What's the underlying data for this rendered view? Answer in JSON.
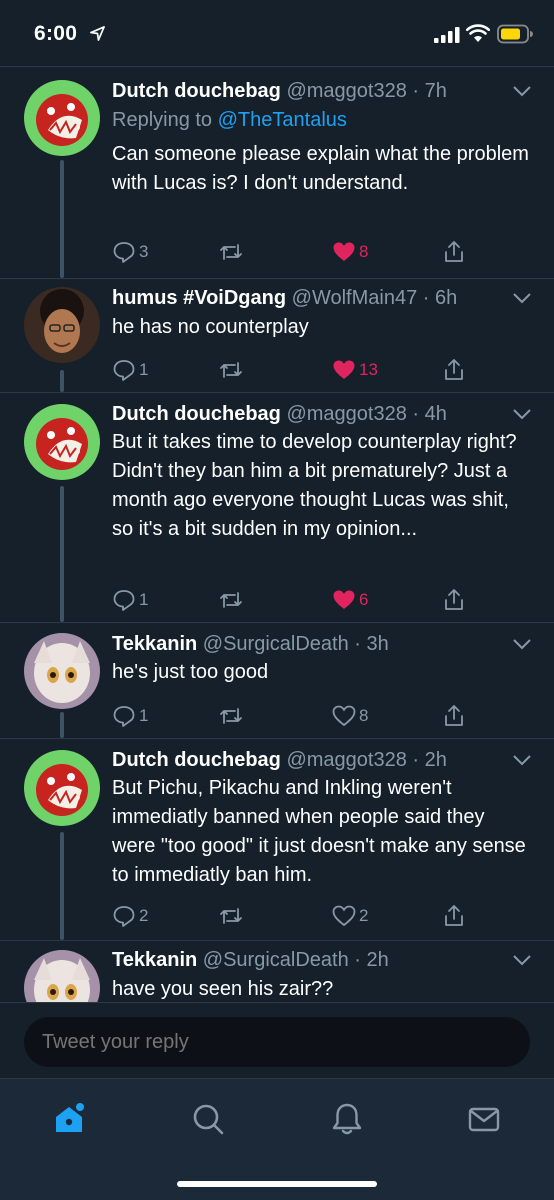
{
  "status_bar": {
    "time": "6:00",
    "icons": [
      "location-arrow-icon",
      "signal-icon",
      "wifi-icon",
      "battery-icon"
    ]
  },
  "tweets": [
    {
      "name": "Dutch douchebag",
      "handle": "@maggot328",
      "time": "· 7h",
      "replying_prefix": "Replying to",
      "replying_to": "@TheTantalus",
      "text": "Can someone please explain what the problem with Lucas is? I don't understand.",
      "replies": "3",
      "retweets": "",
      "likes": "8",
      "liked": true
    },
    {
      "name": "humus #VoiDgang",
      "handle": "@WolfMain47",
      "time": "· 6h",
      "text": "he has no counterplay",
      "replies": "1",
      "retweets": "",
      "likes": "13",
      "liked": true
    },
    {
      "name": "Dutch douchebag",
      "handle": "@maggot328",
      "time": "· 4h",
      "text": "But it takes time to develop counterplay right? Didn't they ban him a bit prematurely? Just a month ago everyone thought Lucas was shit, so it's a bit sudden in my opinion...",
      "replies": "1",
      "retweets": "",
      "likes": "6",
      "liked": true
    },
    {
      "name": "Tekkanin",
      "handle": "@SurgicalDeath",
      "time": "· 3h",
      "text": "he's just too good",
      "replies": "1",
      "retweets": "",
      "likes": "8",
      "liked": false
    },
    {
      "name": "Dutch douchebag",
      "handle": "@maggot328",
      "time": "· 2h",
      "text": "But Pichu, Pikachu and Inkling weren't immediatly banned when people said they were \"too good\" it just doesn't make any sense to immediatly ban him.",
      "replies": "2",
      "retweets": "",
      "likes": "2",
      "liked": false
    },
    {
      "name": "Tekkanin",
      "handle": "@SurgicalDeath",
      "time": "· 2h",
      "text": "have you seen his zair??"
    }
  ],
  "reply_bar": {
    "placeholder": "Tweet your reply"
  },
  "tab_bar": {
    "items": [
      "home-icon",
      "search-icon",
      "notifications-bell-icon",
      "messages-envelope-icon"
    ],
    "active": "home-icon"
  },
  "colors": {
    "background": "#15202b",
    "accent": "#1da1f2",
    "like": "#e0245e",
    "muted": "#8899a6",
    "thread_line": "#3d5466"
  }
}
